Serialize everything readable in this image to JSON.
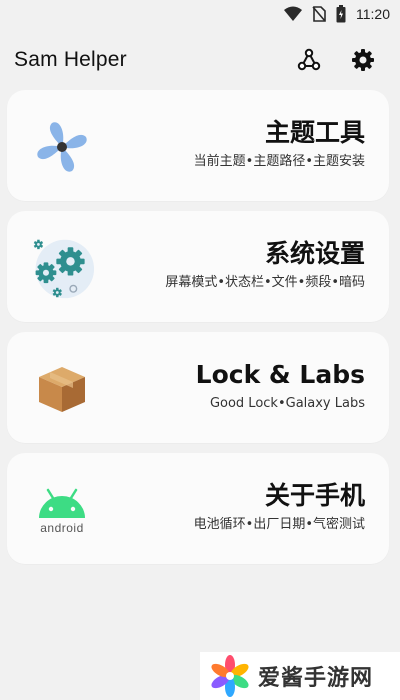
{
  "status_bar": {
    "time": "11:20"
  },
  "app_bar": {
    "title": "Sam Helper"
  },
  "cards": [
    {
      "title": "主题工具",
      "subtitle": "当前主题•主题路径•主题安装"
    },
    {
      "title": "系统设置",
      "subtitle": "屏幕模式•状态栏•文件•频段•暗码"
    },
    {
      "title": "Lock & Labs",
      "subtitle": "Good Lock•Galaxy Labs"
    },
    {
      "title": "关于手机",
      "subtitle": "电池循环•出厂日期•气密测试",
      "icon_text": "android"
    }
  ],
  "watermark": {
    "text": "爱酱手游网"
  },
  "colors": {
    "android_green": "#3ddc84",
    "gear_teal": "#2f8f8f",
    "fan_blue": "#8ab4e8",
    "box_brown": "#c8894a"
  },
  "icons": [
    "wifi-icon",
    "no-sim-icon",
    "battery-icon",
    "share-icon",
    "settings-gear-icon",
    "pinwheel-icon",
    "gears-icon",
    "box-icon",
    "android-icon"
  ]
}
